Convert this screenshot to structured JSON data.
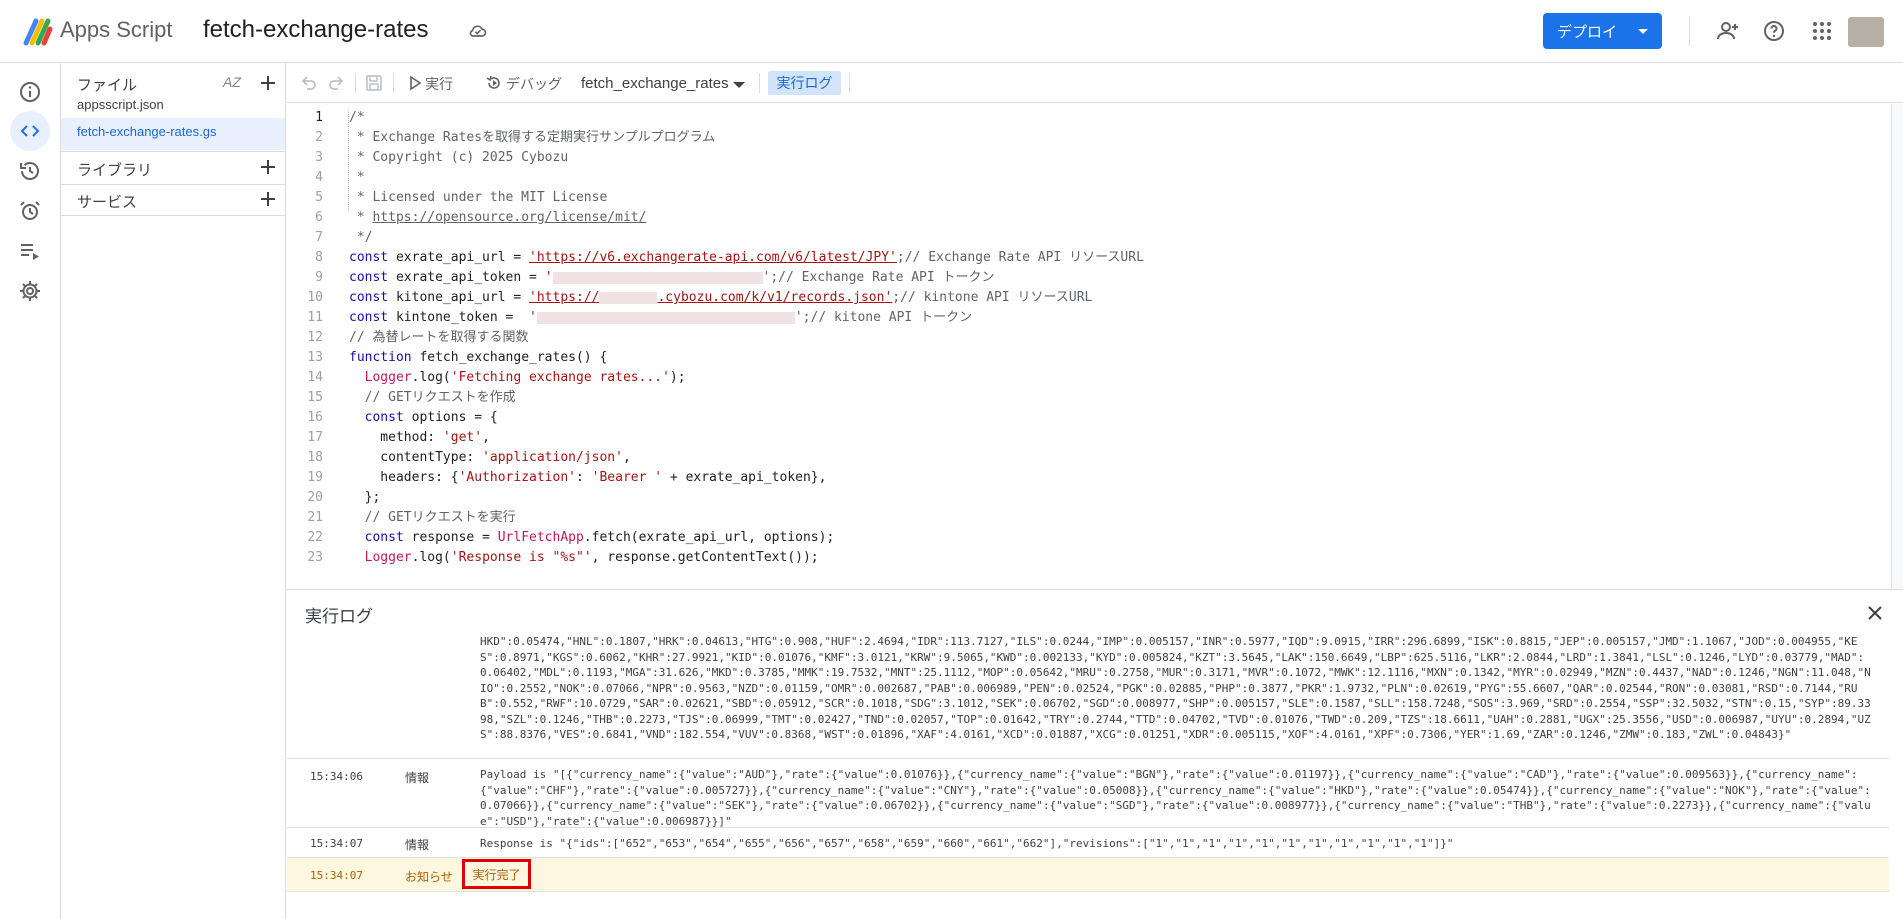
{
  "header": {
    "app_name": "Apps Script",
    "project_name": "fetch-exchange-rates",
    "deploy_label": "デプロイ"
  },
  "files": {
    "section_files": "ファイル",
    "sort_label": "AZ",
    "items": [
      {
        "name": "appsscript.json"
      },
      {
        "name": "fetch-exchange-rates.gs"
      }
    ],
    "section_libraries": "ライブラリ",
    "section_services": "サービス"
  },
  "toolbar": {
    "run_label": "実行",
    "debug_label": "デバッグ",
    "function_name": "fetch_exchange_rates",
    "log_toggle_label": "実行ログ"
  },
  "editor": {
    "line_numbers": [
      "1",
      "2",
      "3",
      "4",
      "5",
      "6",
      "7",
      "8",
      "9",
      "10",
      "11",
      "12",
      "13",
      "14",
      "15",
      "16",
      "17",
      "18",
      "19",
      "20",
      "21",
      "22",
      "23"
    ],
    "lines": {
      "l1": "/*",
      "l2": " * Exchange Ratesを取得する定期実行サンプルプログラム",
      "l3": " * Copyright (c) 2025 Cybozu",
      "l4": " *",
      "l5": " * Licensed under the MIT License",
      "l6_prefix": " * ",
      "l6_url": "https://opensource.org/license/mit/",
      "l7": " */",
      "l8_kw": "const",
      "l8_var": " exrate_api_url = ",
      "l8_str": "'https://v6.exchangerate-api.com/v6/latest/JPY'",
      "l8_cm": ";// Exchange Rate API リソースURL",
      "l9_kw": "const",
      "l9_var": " exrate_api_token = ",
      "l9_str_open": "'",
      "l9_cm": "';// Exchange Rate API トークン",
      "l10_kw": "const",
      "l10_var": " kitone_api_url = ",
      "l10_str_a": "'https://",
      "l10_str_b": ".cybozu.com/k/v1/records.json'",
      "l10_cm": ";// kintone API リソースURL",
      "l11_kw": "const",
      "l11_var": " kintone_token =  ",
      "l11_str_open": "'",
      "l11_cm": "';// kitone API トークン",
      "l12": "// 為替レートを取得する関数",
      "l13_kw": "function",
      "l13_rest": " fetch_exchange_rates() {",
      "l14_cls": "  Logger",
      "l14_a": ".log(",
      "l14_str": "'Fetching exchange rates...'",
      "l14_b": ");",
      "l15": "  // GETリクエストを作成",
      "l16_kw": "  const",
      "l16_rest": " options = {",
      "l17_a": "    method: ",
      "l17_str": "'get'",
      "l17_b": ",",
      "l18_a": "    contentType: ",
      "l18_str": "'application/json'",
      "l18_b": ",",
      "l19_a": "    headers: {",
      "l19_str1": "'Authorization'",
      "l19_b": ": ",
      "l19_str2": "'Bearer '",
      "l19_c": " + exrate_api_token},",
      "l20": "  };",
      "l21": "  // GETリクエストを実行",
      "l22_kw": "  const",
      "l22_a": " response = ",
      "l22_cls": "UrlFetchApp",
      "l22_b": ".fetch(exrate_api_url, options);",
      "l23_cls": "  Logger",
      "l23_a": ".log(",
      "l23_str": "'Response is \"%s\"'",
      "l23_b": ", response.getContentText());"
    }
  },
  "log": {
    "title": "実行ログ",
    "continued_text": "HKD\":0.05474,\"HNL\":0.1807,\"HRK\":0.04613,\"HTG\":0.908,\"HUF\":2.4694,\"IDR\":113.7127,\"ILS\":0.0244,\"IMP\":0.005157,\"INR\":0.5977,\"IQD\":9.0915,\"IRR\":296.6899,\"ISK\":0.8815,\"JEP\":0.005157,\"JMD\":1.1067,\"JOD\":0.004955,\"KES\":0.8971,\"KGS\":0.6062,\"KHR\":27.9921,\"KID\":0.01076,\"KMF\":3.0121,\"KRW\":9.5065,\"KWD\":0.002133,\"KYD\":0.005824,\"KZT\":3.5645,\"LAK\":150.6649,\"LBP\":625.5116,\"LKR\":2.0844,\"LRD\":1.3841,\"LSL\":0.1246,\"LYD\":0.03779,\"MAD\":0.06402,\"MDL\":0.1193,\"MGA\":31.626,\"MKD\":0.3785,\"MMK\":19.7532,\"MNT\":25.1112,\"MOP\":0.05642,\"MRU\":0.2758,\"MUR\":0.3171,\"MVR\":0.1072,\"MWK\":12.1116,\"MXN\":0.1342,\"MYR\":0.02949,\"MZN\":0.4437,\"NAD\":0.1246,\"NGN\":11.048,\"NIO\":0.2552,\"NOK\":0.07066,\"NPR\":0.9563,\"NZD\":0.01159,\"OMR\":0.002687,\"PAB\":0.006989,\"PEN\":0.02524,\"PGK\":0.02885,\"PHP\":0.3877,\"PKR\":1.9732,\"PLN\":0.02619,\"PYG\":55.6607,\"QAR\":0.02544,\"RON\":0.03081,\"RSD\":0.7144,\"RUB\":0.552,\"RWF\":10.0729,\"SAR\":0.02621,\"SBD\":0.05912,\"SCR\":0.1018,\"SDG\":3.1012,\"SEK\":0.06702,\"SGD\":0.008977,\"SHP\":0.005157,\"SLE\":0.1587,\"SLL\":158.7248,\"SOS\":3.969,\"SRD\":0.2554,\"SSP\":32.5032,\"STN\":0.15,\"SYP\":89.3398,\"SZL\":0.1246,\"THB\":0.2273,\"TJS\":0.06999,\"TMT\":0.02427,\"TND\":0.02057,\"TOP\":0.01642,\"TRY\":0.2744,\"TTD\":0.04702,\"TVD\":0.01076,\"TWD\":0.209,\"TZS\":18.6611,\"UAH\":0.2881,\"UGX\":25.3556,\"USD\":0.006987,\"UYU\":0.2894,\"UZS\":88.8376,\"VES\":0.6841,\"VND\":182.554,\"VUV\":0.8368,\"WST\":0.01896,\"XAF\":4.0161,\"XCD\":0.01887,\"XCG\":0.01251,\"XDR\":0.005115,\"XOF\":4.0161,\"XPF\":0.7306,\"YER\":1.69,\"ZAR\":0.1246,\"ZMW\":0.183,\"ZWL\":0.04843}\"",
    "entries": [
      {
        "time": "15:34:06",
        "level": "情報",
        "message": "Payload is \"[{\"currency_name\":{\"value\":\"AUD\"},\"rate\":{\"value\":0.01076}},{\"currency_name\":{\"value\":\"BGN\"},\"rate\":{\"value\":0.01197}},{\"currency_name\":{\"value\":\"CAD\"},\"rate\":{\"value\":0.009563}},{\"currency_name\":{\"value\":\"CHF\"},\"rate\":{\"value\":0.005727}},{\"currency_name\":{\"value\":\"CNY\"},\"rate\":{\"value\":0.05008}},{\"currency_name\":{\"value\":\"HKD\"},\"rate\":{\"value\":0.05474}},{\"currency_name\":{\"value\":\"NOK\"},\"rate\":{\"value\":0.07066}},{\"currency_name\":{\"value\":\"SEK\"},\"rate\":{\"value\":0.06702}},{\"currency_name\":{\"value\":\"SGD\"},\"rate\":{\"value\":0.008977}},{\"currency_name\":{\"value\":\"THB\"},\"rate\":{\"value\":0.2273}},{\"currency_name\":{\"value\":\"USD\"},\"rate\":{\"value\":0.006987}}]\""
      },
      {
        "time": "15:34:07",
        "level": "情報",
        "message": "Response is \"{\"ids\":[\"652\",\"653\",\"654\",\"655\",\"656\",\"657\",\"658\",\"659\",\"660\",\"661\",\"662\"],\"revisions\":[\"1\",\"1\",\"1\",\"1\",\"1\",\"1\",\"1\",\"1\",\"1\",\"1\",\"1\"]}\""
      },
      {
        "time": "15:34:07",
        "level": "お知らせ",
        "message": "実行完了"
      }
    ]
  },
  "colors": {
    "accent": "#1a73e8",
    "notice_bg": "#fef7e0",
    "notice_text": "#b06000",
    "highlight_border": "#e00000"
  },
  "icons": [
    "apps-script-logo-icon",
    "cloud-saved-icon",
    "add-person-icon",
    "help-icon",
    "apps-grid-icon",
    "info-icon",
    "code-icon",
    "history-icon",
    "alarm-icon",
    "executions-icon",
    "settings-icon",
    "plus-icon",
    "undo-icon",
    "redo-icon",
    "save-icon",
    "play-icon",
    "debug-icon",
    "close-icon"
  ]
}
